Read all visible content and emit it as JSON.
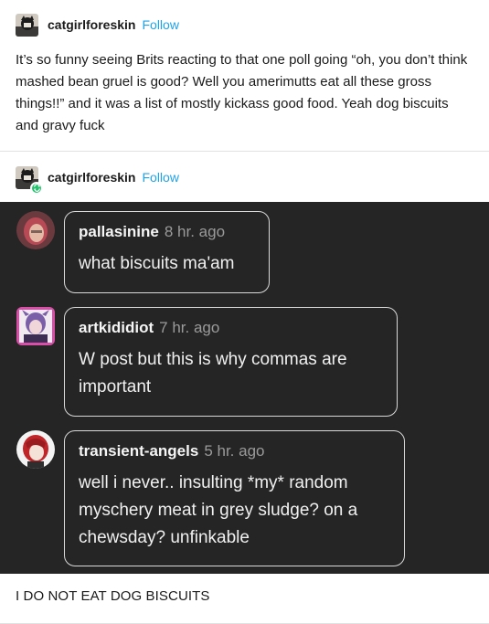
{
  "post": {
    "username": "catgirlforeskin",
    "follow_label": "Follow",
    "body": "It’s so funny seeing Brits reacting to that one poll going “oh, you don’t think mashed bean gruel is good? Well you amerimutts eat all these gross things!!” and it was a list of mostly kickass good food. Yeah dog biscuits and gravy fuck"
  },
  "reblog": {
    "username": "catgirlforeskin",
    "follow_label": "Follow",
    "comments": [
      {
        "user": "pallasinine",
        "time": "8 hr. ago",
        "text": "what biscuits ma'am"
      },
      {
        "user": "artkididiot",
        "time": "7 hr. ago",
        "text": "W post but this is why commas are important"
      },
      {
        "user": "transient-angels",
        "time": "5 hr. ago",
        "text": "well i never.. insulting *my* random myschery meat in grey sludge? on a chewsday? unfinkable"
      }
    ],
    "reply": "I DO NOT EAT DOG BISCUITS"
  },
  "colors": {
    "accent": "#1fa3e8",
    "reblog_badge": "#23c16b",
    "screenshot_bg": "#252525"
  }
}
